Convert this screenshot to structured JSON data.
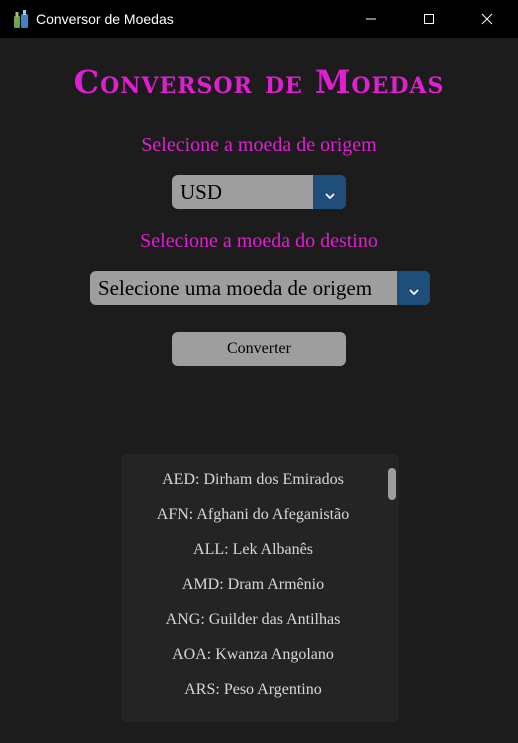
{
  "window": {
    "title": "Conversor de Moedas",
    "icon": "bottles-app-icon",
    "controls": [
      "minimize-icon",
      "maximize-icon",
      "close-icon"
    ]
  },
  "main": {
    "heading": "Conversor de Moedas",
    "origem_label": "Selecione a moeda de origem",
    "origem_value": "USD",
    "destino_label": "Selecione a moeda do destino",
    "destino_value": "Selecione uma moeda de origem",
    "convert_label": "Converter"
  },
  "currencies": [
    "AED: Dirham dos Emirados",
    "AFN: Afghani do Afeganistão",
    "ALL: Lek Albanês",
    "AMD: Dram Armênio",
    "ANG: Guilder das Antilhas",
    "AOA: Kwanza Angolano",
    "ARS: Peso Argentino"
  ],
  "colors": {
    "accent": "#e01ed2",
    "dropdown_arrow_bg": "#1f4e7a",
    "control_bg": "#9e9e9e",
    "window_bg": "#1c1c1c"
  }
}
